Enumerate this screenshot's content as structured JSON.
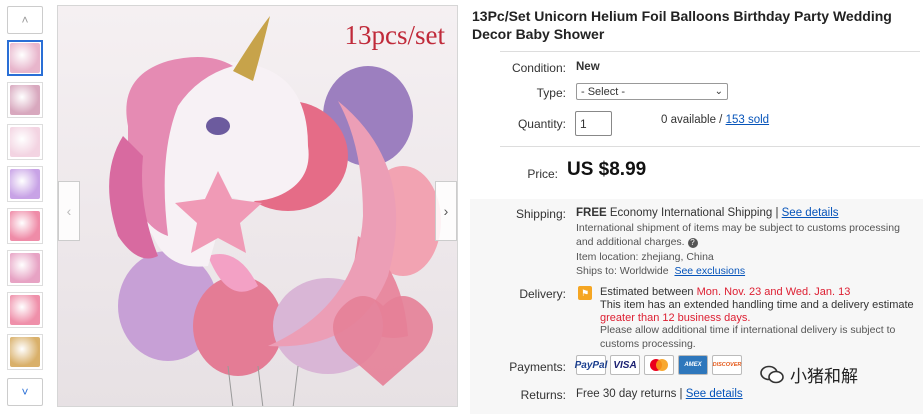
{
  "product": {
    "title": "13Pc/Set Unicorn Helium Foil Balloons Birthday Party Wedding Decor Baby Shower",
    "image_caption": "13pcs/set"
  },
  "thumbnails": [
    {
      "color": "#e8b6cc",
      "active": true
    },
    {
      "color": "#d8a8be",
      "active": false
    },
    {
      "color": "#f3d4e2",
      "active": false
    },
    {
      "color": "#c8a3e6",
      "active": false
    },
    {
      "color": "#ef8ca8",
      "active": false
    },
    {
      "color": "#e7a3c4",
      "active": false
    },
    {
      "color": "#ef90aa",
      "active": false
    },
    {
      "color": "#d9b06a",
      "active": false
    }
  ],
  "condition": {
    "label": "Condition:",
    "value": "New"
  },
  "type": {
    "label": "Type:",
    "selected": "- Select -"
  },
  "quantity": {
    "label": "Quantity:",
    "value": "1",
    "available": "0 available / ",
    "sold": "153 sold"
  },
  "price": {
    "label": "Price:",
    "value": "US $8.99"
  },
  "shipping": {
    "label": "Shipping:",
    "free": "FREE",
    "method": "Economy International Shipping | ",
    "details_link": "See details",
    "note": "International shipment of items may be subject to customs processing and additional charges.",
    "location_label": "Item location: ",
    "location": "zhejiang, China",
    "ships_to_label": "Ships to: ",
    "ships_to": "Worldwide",
    "exclusions_link": "See exclusions"
  },
  "delivery": {
    "label": "Delivery:",
    "estimated_prefix": "Estimated between ",
    "estimated_dates": "Mon. Nov. 23 and Wed. Jan. 13",
    "handling_text": "This item has an extended handling time and a delivery estimate ",
    "handling_highlight": "greater than 12 business days.",
    "note": "Please allow additional time if international delivery is subject to customs processing."
  },
  "payments": {
    "label": "Payments:",
    "methods": [
      "PayPal",
      "VISA",
      "Mastercard",
      "AMEX",
      "DISCOVER"
    ]
  },
  "returns": {
    "label": "Returns:",
    "text": "Free 30 day returns | ",
    "link": "See details"
  },
  "watermark": {
    "text": "小猪和解"
  },
  "colors": {
    "link": "#0654ba",
    "red": "#dd1e31",
    "thumb_active_border": "#2a6fd6"
  }
}
